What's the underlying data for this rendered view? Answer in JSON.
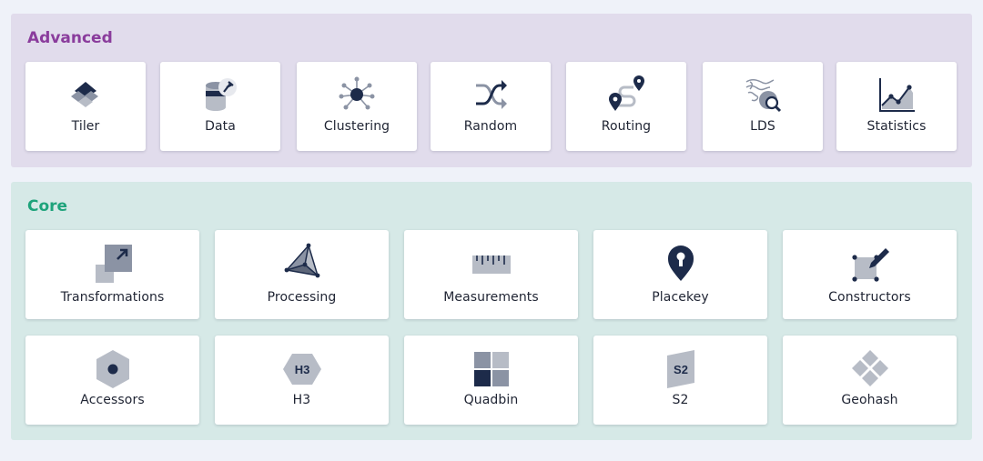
{
  "advanced": {
    "title": "Advanced",
    "items": [
      {
        "label": "Tiler",
        "icon": "tiler-icon"
      },
      {
        "label": "Data",
        "icon": "data-icon"
      },
      {
        "label": "Clustering",
        "icon": "clustering-icon"
      },
      {
        "label": "Random",
        "icon": "random-icon"
      },
      {
        "label": "Routing",
        "icon": "routing-icon"
      },
      {
        "label": "LDS",
        "icon": "lds-icon"
      },
      {
        "label": "Statistics",
        "icon": "statistics-icon"
      }
    ]
  },
  "core": {
    "title": "Core",
    "items": [
      {
        "label": "Transformations",
        "icon": "transformations-icon"
      },
      {
        "label": "Processing",
        "icon": "processing-icon"
      },
      {
        "label": "Measurements",
        "icon": "measurements-icon"
      },
      {
        "label": "Placekey",
        "icon": "placekey-icon"
      },
      {
        "label": "Constructors",
        "icon": "constructors-icon"
      },
      {
        "label": "Accessors",
        "icon": "accessors-icon"
      },
      {
        "label": "H3",
        "icon": "h3-icon",
        "glyph": "H3"
      },
      {
        "label": "Quadbin",
        "icon": "quadbin-icon"
      },
      {
        "label": "S2",
        "icon": "s2-icon",
        "glyph": "S2"
      },
      {
        "label": "Geohash",
        "icon": "geohash-icon"
      }
    ]
  },
  "colors": {
    "advanced_bg": "#e1dcec",
    "advanced_title": "#8a3c9c",
    "core_bg": "#d6e9e7",
    "core_title": "#1ea37b",
    "icon_dark": "#1d2b4a",
    "icon_gray": "#b7bcc6"
  }
}
